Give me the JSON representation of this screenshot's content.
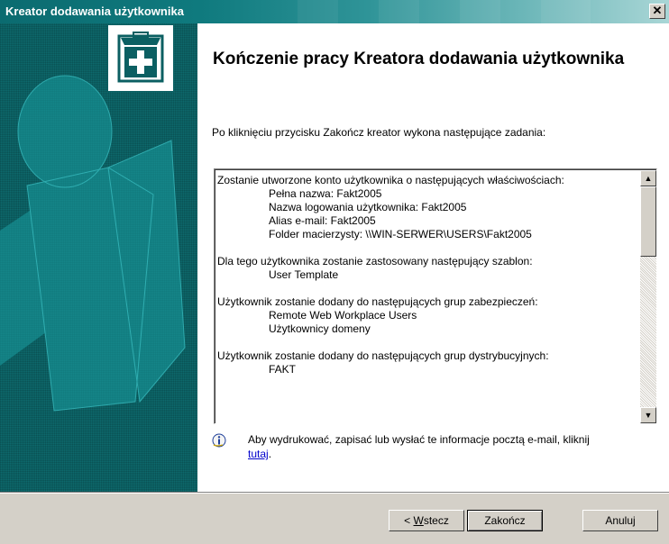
{
  "window": {
    "title": "Kreator dodawania użytkownika",
    "close_glyph": "✕"
  },
  "header": {
    "title": "Kończenie pracy Kreatora dodawania użytkownika",
    "icon": "first-aid-box-icon"
  },
  "intro": "Po kliknięciu przycisku Zakończ kreator wykona następujące zadania:",
  "summary": {
    "lines": [
      {
        "text": "Zostanie utworzone konto użytkownika o następujących właściwościach:",
        "indent": false
      },
      {
        "text": "Pełna nazwa: Fakt2005",
        "indent": true
      },
      {
        "text": "Nazwa logowania użytkownika: Fakt2005",
        "indent": true
      },
      {
        "text": "Alias e-mail: Fakt2005",
        "indent": true
      },
      {
        "text": "Folder macierzysty: \\\\WIN-SERWER\\USERS\\Fakt2005",
        "indent": true
      },
      {
        "text": "",
        "indent": false
      },
      {
        "text": "Dla tego użytkownika zostanie zastosowany następujący szablon:",
        "indent": false
      },
      {
        "text": "User Template",
        "indent": true
      },
      {
        "text": "",
        "indent": false
      },
      {
        "text": "Użytkownik zostanie dodany do następujących grup zabezpieczeń:",
        "indent": false
      },
      {
        "text": "Remote Web Workplace Users",
        "indent": true
      },
      {
        "text": "Użytkownicy domeny",
        "indent": true
      },
      {
        "text": "",
        "indent": false
      },
      {
        "text": "Użytkownik zostanie dodany do następujących grup dystrybucyjnych:",
        "indent": false
      },
      {
        "text": "FAKT",
        "indent": true
      }
    ],
    "scroll_up_glyph": "▲",
    "scroll_down_glyph": "▼"
  },
  "info": {
    "text": "Aby wydrukować, zapisać lub wysłać te informacje pocztą e-mail, kliknij",
    "link": "tutaj",
    "suffix": ".",
    "icon": "info-icon"
  },
  "buttons": {
    "back_prefix": "< ",
    "back_mnemonic": "W",
    "back_rest": "stecz",
    "finish": "Zakończ",
    "cancel": "Anuluj"
  },
  "colors": {
    "sidebar": "#0d6a6d",
    "title_start": "#0b6b70",
    "link": "#0000cc"
  }
}
